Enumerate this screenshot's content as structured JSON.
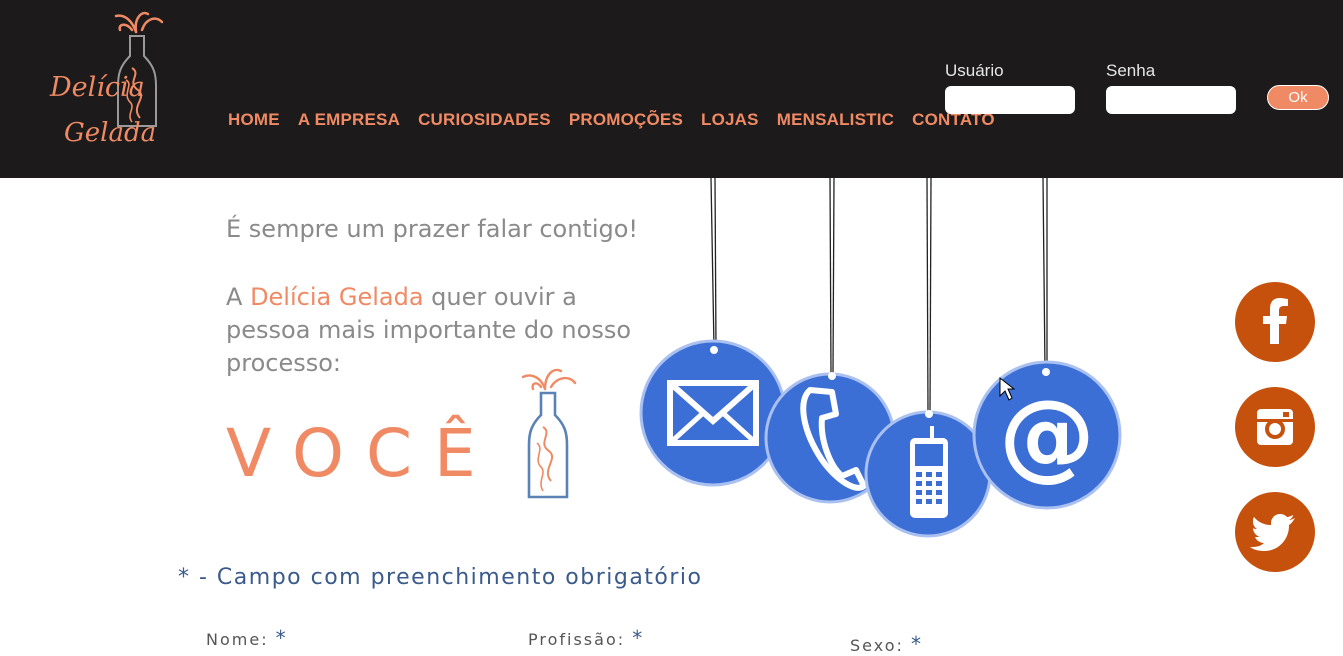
{
  "brand": {
    "logo_line1": "Delícia",
    "logo_line2": "Gelada",
    "accent_color": "#f08a64",
    "header_bg": "#1c1a1a"
  },
  "nav": {
    "items": [
      "HOME",
      "A EMPRESA",
      "CURIOSIDADES",
      "PROMOÇÕES",
      "LOJAS",
      "MENSALISTIC",
      "CONTATO"
    ]
  },
  "login": {
    "user_label": "Usuário",
    "user_value": "",
    "password_label": "Senha",
    "password_value": "",
    "ok_label": "Ok"
  },
  "intro": {
    "line1": "É sempre um prazer falar contigo!",
    "prefix": "A",
    "brand_name": "Delícia Gelada",
    "rest": "quer ouvir a pessoa mais importante do nosso processo:",
    "voce": "VOCÊ"
  },
  "hanging_icons": [
    "envelope-icon",
    "phone-icon",
    "mobile-icon",
    "at-sign-icon"
  ],
  "social": {
    "items": [
      "facebook-icon",
      "instagram-icon",
      "twitter-icon"
    ],
    "color": "#c6510c"
  },
  "form": {
    "required_note": "* - Campo com preenchimento obrigatório",
    "fields": [
      {
        "label": "Nome:",
        "required": "*"
      },
      {
        "label": "Profissão:",
        "required": "*"
      },
      {
        "label": "Sexo:",
        "required": "*"
      }
    ]
  }
}
